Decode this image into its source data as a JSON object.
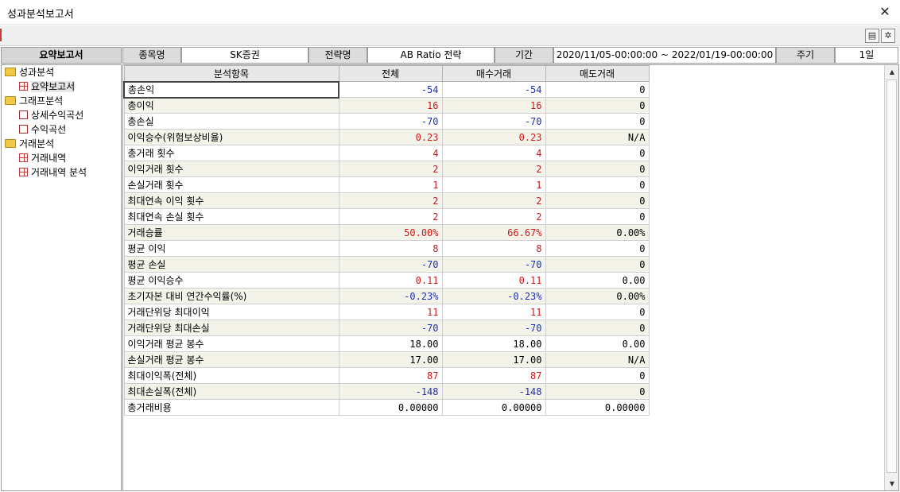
{
  "window": {
    "title": "성과분석보고서",
    "close_glyph": "✕"
  },
  "toolbar": {
    "save_glyph": "▤",
    "settings_glyph": "✲"
  },
  "info": {
    "main_label": "요약보고서",
    "symbol_label": "종목명",
    "symbol_value": "SK증권",
    "strategy_label": "전략명",
    "strategy_value": "AB Ratio 전략",
    "period_label": "기간",
    "period_value": "2020/11/05-00:00:00 ~ 2022/01/19-00:00:00",
    "cycle_label": "주기",
    "cycle_value": "1일"
  },
  "tree": {
    "groups": [
      {
        "label": "성과분석",
        "items": [
          {
            "label": "요약보고서",
            "icon": "grid-icon"
          }
        ]
      },
      {
        "label": "그래프분석",
        "items": [
          {
            "label": "상세수익곡선",
            "icon": "chart-icon"
          },
          {
            "label": "수익곡선",
            "icon": "chart-icon"
          }
        ]
      },
      {
        "label": "거래분석",
        "items": [
          {
            "label": "거래내역",
            "icon": "grid-icon"
          },
          {
            "label": "거래내역 분석",
            "icon": "grid-icon"
          }
        ]
      }
    ]
  },
  "table": {
    "headers": [
      "분석항목",
      "전체",
      "매수거래",
      "매도거래"
    ],
    "rows": [
      {
        "name": "총손익",
        "total": "-54",
        "buy": "-54",
        "sell": "0",
        "c": [
          "blue",
          "blue",
          "black"
        ]
      },
      {
        "name": "총이익",
        "total": "16",
        "buy": "16",
        "sell": "0",
        "c": [
          "red",
          "red",
          "black"
        ]
      },
      {
        "name": "총손실",
        "total": "-70",
        "buy": "-70",
        "sell": "0",
        "c": [
          "blue",
          "blue",
          "black"
        ]
      },
      {
        "name": "이익승수(위험보상비율)",
        "total": "0.23",
        "buy": "0.23",
        "sell": "N/A",
        "c": [
          "red",
          "red",
          "black"
        ]
      },
      {
        "name": "총거래 횟수",
        "total": "4",
        "buy": "4",
        "sell": "0",
        "c": [
          "red",
          "red",
          "black"
        ]
      },
      {
        "name": "이익거래 횟수",
        "total": "2",
        "buy": "2",
        "sell": "0",
        "c": [
          "red",
          "red",
          "black"
        ]
      },
      {
        "name": "손실거래 횟수",
        "total": "1",
        "buy": "1",
        "sell": "0",
        "c": [
          "red",
          "red",
          "black"
        ]
      },
      {
        "name": "최대연속 이익 횟수",
        "total": "2",
        "buy": "2",
        "sell": "0",
        "c": [
          "red",
          "red",
          "black"
        ]
      },
      {
        "name": "최대연속 손실 횟수",
        "total": "2",
        "buy": "2",
        "sell": "0",
        "c": [
          "red",
          "red",
          "black"
        ]
      },
      {
        "name": "거래승률",
        "total": "50.00%",
        "buy": "66.67%",
        "sell": "0.00%",
        "c": [
          "red",
          "red",
          "black"
        ]
      },
      {
        "name": "평균 이익",
        "total": "8",
        "buy": "8",
        "sell": "0",
        "c": [
          "red",
          "red",
          "black"
        ]
      },
      {
        "name": "평균 손실",
        "total": "-70",
        "buy": "-70",
        "sell": "0",
        "c": [
          "blue",
          "blue",
          "black"
        ]
      },
      {
        "name": "평균 이익승수",
        "total": "0.11",
        "buy": "0.11",
        "sell": "0.00",
        "c": [
          "red",
          "red",
          "black"
        ]
      },
      {
        "name": "초기자본 대비 연간수익률(%)",
        "total": "-0.23%",
        "buy": "-0.23%",
        "sell": "0.00%",
        "c": [
          "blue",
          "blue",
          "black"
        ]
      },
      {
        "name": "거래단위당 최대이익",
        "total": "11",
        "buy": "11",
        "sell": "0",
        "c": [
          "red",
          "red",
          "black"
        ]
      },
      {
        "name": "거래단위당 최대손실",
        "total": "-70",
        "buy": "-70",
        "sell": "0",
        "c": [
          "blue",
          "blue",
          "black"
        ]
      },
      {
        "name": "이익거래 평균 봉수",
        "total": "18.00",
        "buy": "18.00",
        "sell": "0.00",
        "c": [
          "black",
          "black",
          "black"
        ]
      },
      {
        "name": "손실거래 평균 봉수",
        "total": "17.00",
        "buy": "17.00",
        "sell": "N/A",
        "c": [
          "black",
          "black",
          "black"
        ]
      },
      {
        "name": "최대이익폭(전체)",
        "total": "87",
        "buy": "87",
        "sell": "0",
        "c": [
          "red",
          "red",
          "black"
        ]
      },
      {
        "name": "최대손실폭(전체)",
        "total": "-148",
        "buy": "-148",
        "sell": "0",
        "c": [
          "blue",
          "blue",
          "black"
        ]
      },
      {
        "name": "총거래비용",
        "total": "0.00000",
        "buy": "0.00000",
        "sell": "0.00000",
        "c": [
          "black",
          "black",
          "black"
        ]
      }
    ]
  },
  "scrollbar": {
    "up_glyph": "▲",
    "down_glyph": "▼"
  },
  "colors": {
    "positive": "#d01818",
    "negative": "#1f2fb8"
  }
}
